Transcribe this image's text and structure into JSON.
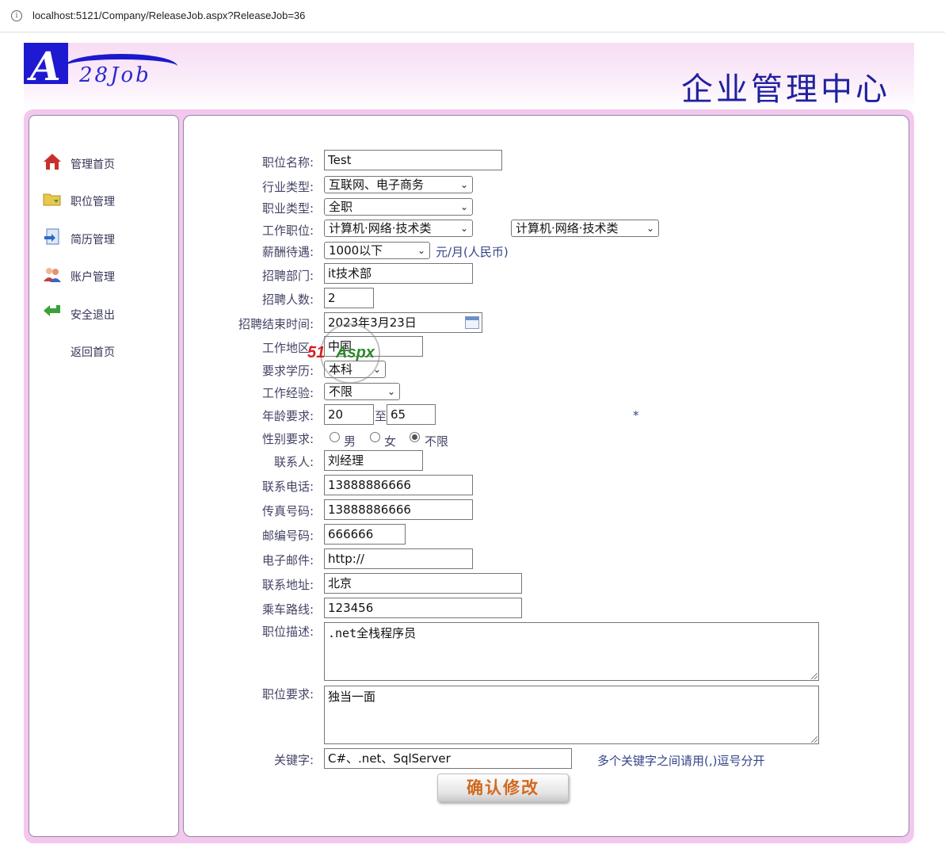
{
  "browser": {
    "url": "localhost:5121/Company/ReleaseJob.aspx?ReleaseJob=36"
  },
  "header": {
    "logo_letter": "A",
    "logo_text": "28Job",
    "title": "企业管理中心"
  },
  "sidebar": {
    "items": [
      {
        "label": "管理首页",
        "icon": "home-icon"
      },
      {
        "label": "职位管理",
        "icon": "folder-icon"
      },
      {
        "label": "简历管理",
        "icon": "resume-icon"
      },
      {
        "label": "账户管理",
        "icon": "users-icon"
      },
      {
        "label": "安全退出",
        "icon": "exit-arrow-icon"
      },
      {
        "label": "返回首页",
        "icon": ""
      }
    ]
  },
  "form": {
    "job_name": {
      "label": "职位名称:",
      "value": "Test"
    },
    "industry": {
      "label": "行业类型:",
      "value": "互联网、电子商务"
    },
    "job_type": {
      "label": "职业类型:",
      "value": "全职"
    },
    "position": {
      "label": "工作职位:",
      "value1": "计算机·网络·技术类",
      "value2": "计算机·网络·技术类"
    },
    "salary": {
      "label": "薪酬待遇:",
      "value": "1000以下",
      "unit": "元/月(人民币)"
    },
    "department": {
      "label": "招聘部门:",
      "value": "it技术部"
    },
    "headcount": {
      "label": "招聘人数:",
      "value": "2"
    },
    "end_date": {
      "label": "招聘结束时间:",
      "value": "2023年3月23日"
    },
    "location": {
      "label": "工作地区:",
      "value": "中国"
    },
    "education": {
      "label": "要求学历:",
      "value": "本科"
    },
    "experience": {
      "label": "工作经验:",
      "value": "不限"
    },
    "age": {
      "label": "年龄要求:",
      "min": "20",
      "to": "至",
      "max": "65",
      "required_mark": "*"
    },
    "gender": {
      "label": "性别要求:",
      "options": [
        "男",
        "女",
        "不限"
      ],
      "selected": "不限"
    },
    "contact": {
      "label": "联系人:",
      "value": "刘经理"
    },
    "phone": {
      "label": "联系电话:",
      "value": "13888886666"
    },
    "fax": {
      "label": "传真号码:",
      "value": "13888886666"
    },
    "zip": {
      "label": "邮编号码:",
      "value": "666666"
    },
    "email": {
      "label": "电子邮件:",
      "value": "http://"
    },
    "address": {
      "label": "联系地址:",
      "value": "北京"
    },
    "bus_route": {
      "label": "乘车路线:",
      "value": "123456"
    },
    "description": {
      "label": "职位描述:",
      "value": ".net全栈程序员"
    },
    "requirements": {
      "label": "职位要求:",
      "value": "独当一面"
    },
    "keywords": {
      "label": "关键字:",
      "value": "C#、.net、SqlServer",
      "hint": "多个关键字之间请用(,)逗号分开"
    },
    "submit_label": "确认修改"
  },
  "watermark": {
    "part1": "51",
    "part2": "Aspx"
  }
}
